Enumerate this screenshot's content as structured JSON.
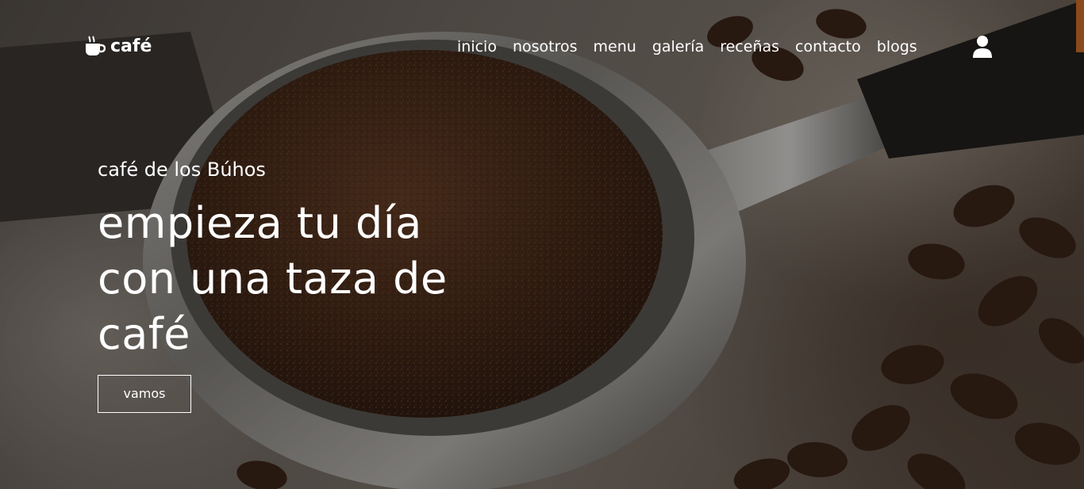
{
  "brand": {
    "name": "café",
    "logo_icon": "coffee-cup-icon"
  },
  "nav": {
    "items": [
      {
        "label": "inicio"
      },
      {
        "label": "nosotros"
      },
      {
        "label": "menu"
      },
      {
        "label": "galería"
      },
      {
        "label": "receñas"
      },
      {
        "label": "contacto"
      },
      {
        "label": "blogs"
      }
    ],
    "user_icon": "user-icon"
  },
  "hero": {
    "subtitle": "café de los Búhos",
    "headline_line1": "empieza tu día",
    "headline_line2": "con una taza de",
    "headline_line3": "café",
    "cta_label": "vamos",
    "background": "coffee-portafilter-photo"
  },
  "colors": {
    "text": "#ffffff",
    "accent": "#8a4a1c",
    "overlay": "#0f0c0a"
  }
}
